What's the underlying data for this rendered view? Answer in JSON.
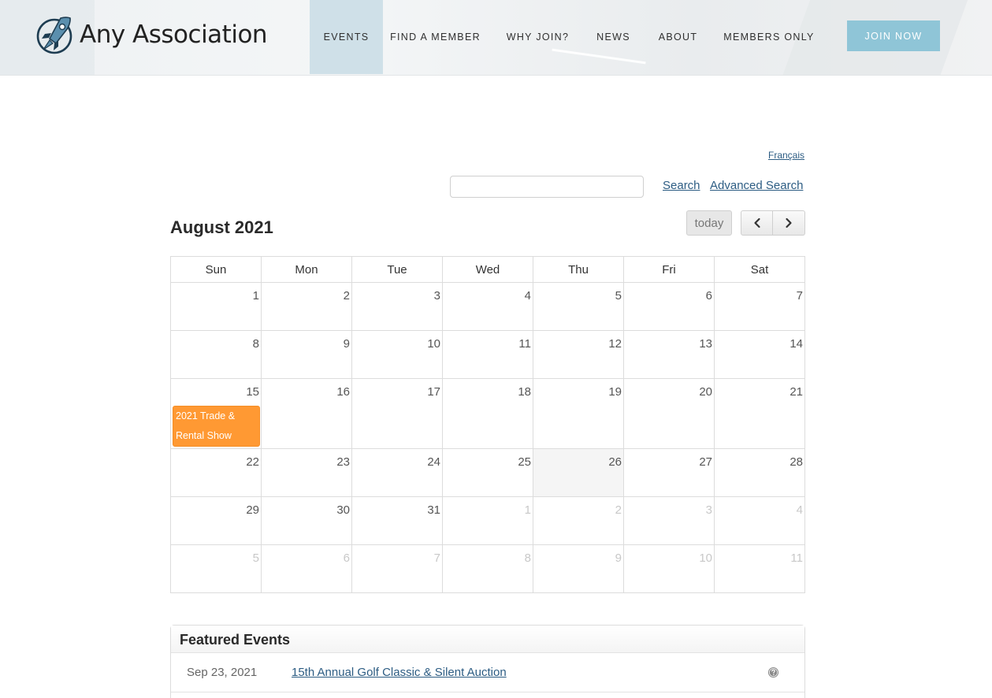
{
  "site": {
    "name": "Any Association",
    "logo_icon": "rocket-icon"
  },
  "nav": {
    "items": [
      {
        "label": "EVENTS",
        "active": true
      },
      {
        "label": "FIND A MEMBER",
        "active": false
      },
      {
        "label": "WHY JOIN?",
        "active": false
      },
      {
        "label": "NEWS",
        "active": false
      },
      {
        "label": "ABOUT",
        "active": false
      },
      {
        "label": "MEMBERS ONLY",
        "active": false
      }
    ],
    "join_label": "JOIN NOW"
  },
  "language_link": "Français",
  "search": {
    "value": "",
    "placeholder": "",
    "search_label": "Search",
    "advanced_label": "Advanced Search"
  },
  "calendar": {
    "month_title": "August 2021",
    "today_label": "today",
    "prev_icon": "chevron-left-icon",
    "next_icon": "chevron-right-icon",
    "weekdays": [
      "Sun",
      "Mon",
      "Tue",
      "Wed",
      "Thu",
      "Fri",
      "Sat"
    ],
    "weeks": [
      [
        "1",
        "2",
        "3",
        "4",
        "5",
        "6",
        "7"
      ],
      [
        "8",
        "9",
        "10",
        "11",
        "12",
        "13",
        "14"
      ],
      [
        "15",
        "16",
        "17",
        "18",
        "19",
        "20",
        "21"
      ],
      [
        "22",
        "23",
        "24",
        "25",
        "26",
        "27",
        "28"
      ],
      [
        "29",
        "30",
        "31",
        "1",
        "2",
        "3",
        "4"
      ],
      [
        "5",
        "6",
        "7",
        "8",
        "9",
        "10",
        "11"
      ]
    ],
    "today_date": "26",
    "events": [
      {
        "date": "15",
        "title": "2021 Trade & Rental Show",
        "color": "#ff9933"
      }
    ]
  },
  "featured": {
    "title": "Featured Events",
    "items": [
      {
        "date": "Sep 23, 2021",
        "name": "15th Annual Golf Classic & Silent Auction",
        "icon": "help-icon"
      }
    ]
  },
  "colors": {
    "nav_active_bg": "#cfe0e8",
    "join_button": "#8fc5d7",
    "link": "#2c5c83",
    "event_chip": "#ff9933"
  }
}
